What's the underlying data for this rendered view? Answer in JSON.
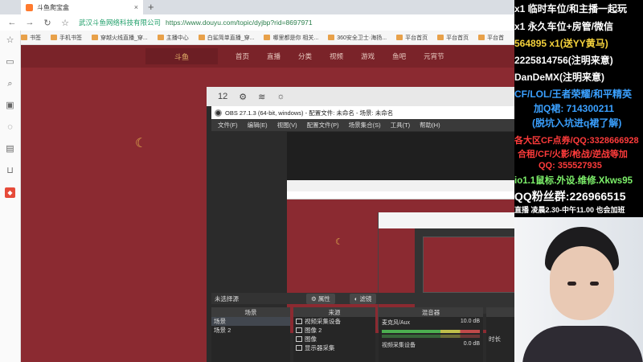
{
  "browser": {
    "tab_title": "斗鱼爬宝盒",
    "new_tab": "+",
    "tab_close": "×",
    "site_name": "武汉斗鱼网络科技有限公司",
    "url": "https://www.douyu.com/topic/dyjbp?rid=8697971",
    "bookmarks": [
      "书签",
      "手机书签",
      "穿越火线直播_穿...",
      "主播中心",
      "白鲨简单直播_穿...",
      "哪里都是你 相关...",
      "360安全卫士·海扬...",
      "平台首页",
      "平台首页",
      "平台首"
    ]
  },
  "douyu_page": {
    "logo": "斗鱼",
    "nav": [
      "首页",
      "直播",
      "分类",
      "视频",
      "游戏",
      "鱼吧",
      "元宵节"
    ]
  },
  "obs": {
    "toolbar_num": "12",
    "title": "OBS 27.1.3 (64-bit, windows) - 配置文件: 未命名 - 场景: 未命名",
    "menu": [
      "文件(F)",
      "编辑(E)",
      "视图(V)",
      "配置文件(P)",
      "场景集合(S)",
      "工具(T)",
      "帮助(H)"
    ],
    "no_source": "未选择源",
    "properties_btn": "属性",
    "filters_btn": "滤镜",
    "scenes_header": "场景",
    "scenes": [
      "场景",
      "场景 2"
    ],
    "sources_header": "来源",
    "sources": [
      "视频采集设备",
      "图像 2",
      "图像",
      "显示器采集"
    ],
    "mixer_header": "混音器",
    "mixer": [
      {
        "name": "麦克风/Aux",
        "db": "10.0 dB"
      },
      {
        "name": "视频采集设备",
        "db": "0.0 dB"
      }
    ],
    "transition_label": "时长"
  },
  "overlay": {
    "lines": [
      {
        "text": "x1 临时车位/和主播一起玩",
        "color": "#ffffff"
      },
      {
        "text": "x1 永久车位+房管/微信",
        "color": "#ffffff"
      },
      {
        "text": "564895 x1(送YY黄马)",
        "color": "#f5d23c"
      },
      {
        "text": "2225814756(注明来意)",
        "color": "#ffffff"
      },
      {
        "text": "DanDeMX(注明来意)",
        "color": "#ffffff"
      },
      {
        "text": "CF/LOL/王者荣耀/和平精英",
        "color": "#3aa0ff"
      },
      {
        "text": "加Q裙: 714300211",
        "color": "#3aa0ff"
      },
      {
        "text": "(脱坑入坑进q裙了解)",
        "color": "#3aa0ff"
      },
      {
        "text": "各大区CF点券/QQ:3328666928",
        "color": "#ff3b3b"
      },
      {
        "text": "合租/CF/火影/枪战/逆战等加",
        "color": "#ff3b3b"
      },
      {
        "text": "QQ: 355527935",
        "color": "#ff3b3b"
      },
      {
        "text": "io1.1鼠标.外设.维修.Xkws95",
        "color": "#7df06a"
      },
      {
        "text": "QQ粉丝群:226966515",
        "color": "#ffffff"
      },
      {
        "text": "直播 凌晨2.30-中午11.00 也会加班",
        "color": "#ffffff"
      }
    ]
  }
}
